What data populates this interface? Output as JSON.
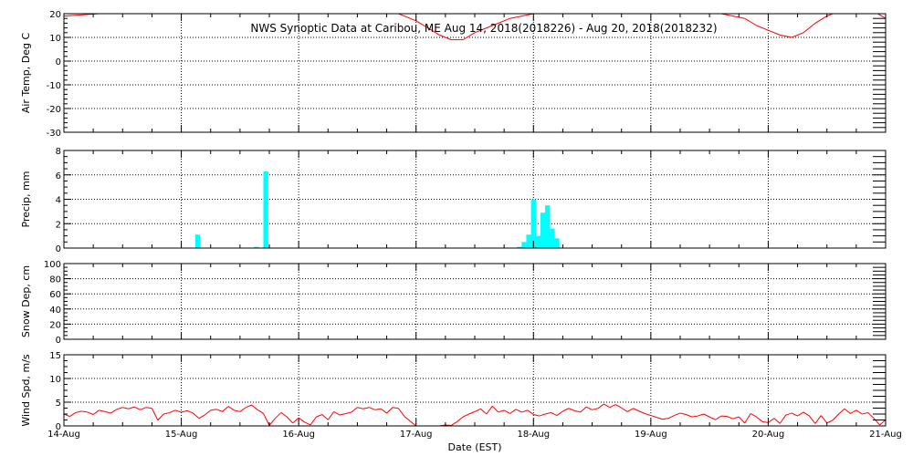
{
  "chart_data": {
    "type": "multi-panel",
    "title": "NWS Synoptic Data at Caribou, ME   Aug 14, 2018(2018226) - Aug 20, 2018(2018232)",
    "xlabel": "Date (EST)",
    "x_ticks": [
      "14-Aug",
      "15-Aug",
      "16-Aug",
      "17-Aug",
      "18-Aug",
      "19-Aug",
      "20-Aug",
      "21-Aug"
    ],
    "panels": [
      {
        "id": "air-temp",
        "type": "line",
        "ylabel": "Air Temp, Deg C",
        "ylim": [
          -30,
          20
        ],
        "yticks": [
          -30,
          -20,
          -10,
          0,
          10,
          20
        ],
        "color": "#ff0000",
        "series": [
          {
            "points": [
              [
                0.0,
                19
              ],
              [
                0.3,
                20
              ],
              [
                0.5,
                21
              ],
              [
                1.0,
                22
              ],
              [
                1.5,
                23
              ],
              [
                2.0,
                24
              ],
              [
                2.5,
                23
              ],
              [
                2.8,
                21
              ],
              [
                3.0,
                17
              ],
              [
                3.1,
                14
              ],
              [
                3.2,
                11
              ],
              [
                3.3,
                9
              ],
              [
                3.4,
                9
              ],
              [
                3.5,
                12
              ],
              [
                3.6,
                14
              ],
              [
                3.8,
                18
              ],
              [
                4.0,
                20
              ],
              [
                4.5,
                22
              ],
              [
                5.0,
                22
              ],
              [
                5.4,
                21
              ],
              [
                5.6,
                20
              ],
              [
                5.8,
                18
              ],
              [
                5.9,
                15
              ],
              [
                6.0,
                13
              ],
              [
                6.1,
                11
              ],
              [
                6.2,
                10
              ],
              [
                6.3,
                12
              ],
              [
                6.4,
                16
              ],
              [
                6.5,
                19
              ],
              [
                6.7,
                23
              ],
              [
                6.9,
                21
              ],
              [
                7.0,
                18
              ]
            ]
          }
        ]
      },
      {
        "id": "precip",
        "type": "bar",
        "ylabel": "Precip, mm",
        "ylim": [
          0,
          8
        ],
        "yticks": [
          0,
          2,
          4,
          6,
          8
        ],
        "color": "#00ffff",
        "series": [
          {
            "points": [
              [
                1.14,
                1.1
              ],
              [
                1.64,
                0.1
              ],
              [
                1.72,
                6.3
              ],
              [
                3.88,
                0.1
              ],
              [
                3.92,
                0.5
              ],
              [
                3.96,
                1.1
              ],
              [
                4.0,
                4.0
              ],
              [
                4.04,
                1.0
              ],
              [
                4.08,
                2.9
              ],
              [
                4.12,
                3.5
              ],
              [
                4.16,
                1.6
              ],
              [
                4.2,
                0.8
              ]
            ]
          }
        ]
      },
      {
        "id": "snow-depth",
        "type": "line",
        "ylabel": "Snow Dep, cm",
        "ylim": [
          0,
          100
        ],
        "yticks": [
          0,
          20,
          40,
          60,
          80,
          100
        ],
        "color": "#ff0000",
        "series": [
          {
            "points": []
          }
        ]
      },
      {
        "id": "wind-speed",
        "type": "line",
        "ylabel": "Wind Spd, m/s",
        "ylim": [
          0,
          15
        ],
        "yticks": [
          0,
          5,
          10,
          15
        ],
        "color": "#ff0000",
        "series": [
          {
            "points": [
              [
                0.0,
                2.5
              ],
              [
                0.05,
                2.0
              ],
              [
                0.1,
                2.8
              ],
              [
                0.15,
                3.1
              ],
              [
                0.2,
                2.9
              ],
              [
                0.25,
                2.4
              ],
              [
                0.3,
                3.3
              ],
              [
                0.35,
                3.0
              ],
              [
                0.4,
                2.7
              ],
              [
                0.45,
                3.5
              ],
              [
                0.5,
                3.9
              ],
              [
                0.55,
                3.6
              ],
              [
                0.6,
                4.0
              ],
              [
                0.65,
                3.4
              ],
              [
                0.7,
                3.9
              ],
              [
                0.75,
                3.7
              ],
              [
                0.8,
                1.2
              ],
              [
                0.85,
                2.5
              ],
              [
                0.9,
                2.8
              ],
              [
                0.95,
                3.3
              ],
              [
                1.0,
                2.9
              ],
              [
                1.05,
                3.2
              ],
              [
                1.1,
                2.7
              ],
              [
                1.15,
                1.6
              ],
              [
                1.2,
                2.3
              ],
              [
                1.25,
                3.3
              ],
              [
                1.3,
                3.5
              ],
              [
                1.35,
                3.0
              ],
              [
                1.4,
                4.1
              ],
              [
                1.45,
                3.3
              ],
              [
                1.5,
                3.0
              ],
              [
                1.55,
                3.9
              ],
              [
                1.6,
                4.4
              ],
              [
                1.65,
                3.4
              ],
              [
                1.7,
                2.6
              ],
              [
                1.75,
                0.1
              ],
              [
                1.8,
                1.6
              ],
              [
                1.85,
                2.8
              ],
              [
                1.9,
                1.9
              ],
              [
                1.95,
                0.6
              ],
              [
                2.0,
                1.7
              ],
              [
                2.05,
                0.8
              ],
              [
                2.1,
                0.2
              ],
              [
                2.15,
                1.9
              ],
              [
                2.2,
                2.4
              ],
              [
                2.25,
                1.3
              ],
              [
                2.3,
                3.0
              ],
              [
                2.35,
                2.3
              ],
              [
                2.4,
                2.6
              ],
              [
                2.45,
                2.9
              ],
              [
                2.5,
                3.9
              ],
              [
                2.55,
                3.6
              ],
              [
                2.6,
                3.9
              ],
              [
                2.65,
                3.4
              ],
              [
                2.7,
                3.6
              ],
              [
                2.75,
                2.7
              ],
              [
                2.8,
                3.9
              ],
              [
                2.85,
                3.7
              ],
              [
                2.9,
                2.0
              ],
              [
                2.95,
                1.0
              ],
              [
                3.0,
                0.0
              ],
              [
                3.05,
                0.0
              ],
              [
                3.1,
                0.0
              ],
              [
                3.15,
                0.0
              ],
              [
                3.2,
                0.0
              ],
              [
                3.25,
                0.2
              ],
              [
                3.3,
                0.1
              ],
              [
                3.35,
                0.9
              ],
              [
                3.4,
                1.9
              ],
              [
                3.45,
                2.5
              ],
              [
                3.5,
                3.0
              ],
              [
                3.55,
                3.6
              ],
              [
                3.6,
                2.5
              ],
              [
                3.65,
                4.2
              ],
              [
                3.7,
                2.9
              ],
              [
                3.75,
                3.3
              ],
              [
                3.8,
                2.6
              ],
              [
                3.85,
                3.5
              ],
              [
                3.9,
                2.9
              ],
              [
                3.95,
                3.3
              ],
              [
                4.0,
                2.4
              ],
              [
                4.05,
                2.1
              ],
              [
                4.1,
                2.5
              ],
              [
                4.15,
                2.8
              ],
              [
                4.2,
                2.2
              ],
              [
                4.25,
                3.1
              ],
              [
                4.3,
                3.7
              ],
              [
                4.35,
                3.2
              ],
              [
                4.4,
                2.9
              ],
              [
                4.45,
                4.0
              ],
              [
                4.5,
                3.4
              ],
              [
                4.55,
                3.7
              ],
              [
                4.6,
                4.6
              ],
              [
                4.65,
                3.9
              ],
              [
                4.7,
                4.5
              ],
              [
                4.75,
                3.8
              ],
              [
                4.8,
                3.0
              ],
              [
                4.85,
                3.7
              ],
              [
                4.9,
                3.1
              ],
              [
                4.95,
                2.6
              ],
              [
                5.0,
                2.2
              ],
              [
                5.05,
                1.8
              ],
              [
                5.1,
                1.4
              ],
              [
                5.15,
                1.6
              ],
              [
                5.2,
                2.2
              ],
              [
                5.25,
                2.7
              ],
              [
                5.3,
                2.4
              ],
              [
                5.35,
                1.9
              ],
              [
                5.4,
                2.1
              ],
              [
                5.45,
                2.5
              ],
              [
                5.5,
                1.9
              ],
              [
                5.55,
                1.3
              ],
              [
                5.6,
                2.1
              ],
              [
                5.65,
                2.0
              ],
              [
                5.7,
                1.5
              ],
              [
                5.75,
                1.9
              ],
              [
                5.8,
                0.6
              ],
              [
                5.85,
                2.6
              ],
              [
                5.9,
                1.9
              ],
              [
                5.95,
                0.9
              ],
              [
                6.0,
                0.7
              ],
              [
                6.05,
                1.6
              ],
              [
                6.1,
                0.5
              ],
              [
                6.15,
                2.3
              ],
              [
                6.2,
                2.7
              ],
              [
                6.25,
                2.1
              ],
              [
                6.3,
                2.9
              ],
              [
                6.35,
                2.1
              ],
              [
                6.4,
                0.5
              ],
              [
                6.45,
                2.2
              ],
              [
                6.5,
                0.6
              ],
              [
                6.55,
                1.2
              ],
              [
                6.6,
                2.5
              ],
              [
                6.65,
                3.6
              ],
              [
                6.7,
                2.6
              ],
              [
                6.75,
                3.3
              ],
              [
                6.8,
                2.5
              ],
              [
                6.85,
                2.8
              ],
              [
                6.9,
                1.6
              ],
              [
                6.95,
                0.2
              ],
              [
                7.0,
                1.3
              ]
            ]
          }
        ]
      }
    ]
  }
}
